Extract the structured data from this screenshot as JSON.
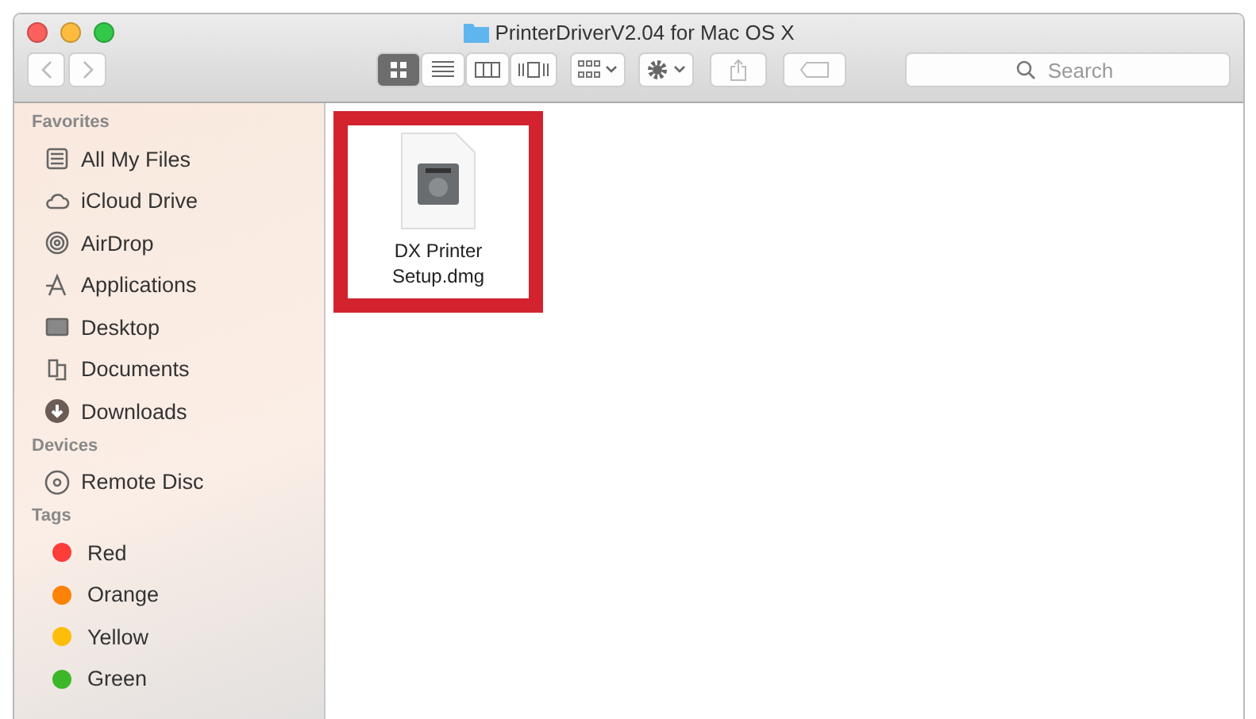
{
  "window": {
    "title": "PrinterDriverV2.04 for Mac OS X"
  },
  "toolbar": {
    "views": [
      {
        "selected": true
      },
      {
        "selected": false
      },
      {
        "selected": false
      },
      {
        "selected": false
      }
    ],
    "search": {
      "placeholder": "Search"
    }
  },
  "sidebar": {
    "sections": [
      {
        "title": "Favorites",
        "kind": "places",
        "items": [
          {
            "label": "All My Files"
          },
          {
            "label": "iCloud Drive"
          },
          {
            "label": "AirDrop"
          },
          {
            "label": "Applications"
          },
          {
            "label": "Desktop"
          },
          {
            "label": "Documents"
          },
          {
            "label": "Downloads"
          }
        ]
      },
      {
        "title": "Devices",
        "kind": "devices",
        "items": [
          {
            "label": "Remote Disc"
          }
        ]
      },
      {
        "title": "Tags",
        "kind": "tags",
        "items": [
          {
            "label": "Red",
            "color": "#fc3d39"
          },
          {
            "label": "Orange",
            "color": "#fd8208"
          },
          {
            "label": "Yellow",
            "color": "#fdbd09"
          },
          {
            "label": "Green",
            "color": "#3cb72a"
          }
        ]
      }
    ]
  },
  "files": [
    {
      "name": "DX Printer Setup.dmg",
      "highlighted": true
    }
  ]
}
